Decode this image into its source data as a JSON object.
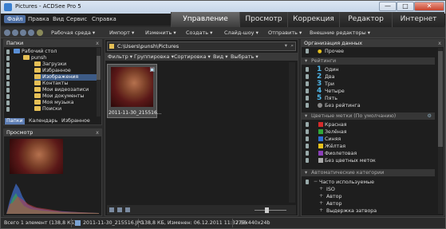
{
  "window": {
    "title": "Pictures - ACDSee Pro 5",
    "minimize": "—",
    "maximize": "□",
    "close": "✕"
  },
  "menu": [
    "Файл",
    "Правка",
    "Вид",
    "Сервис",
    "Справка"
  ],
  "modes": [
    "Управление",
    "Просмотр",
    "Коррекция",
    "Редактор",
    "Интернет"
  ],
  "toolbar": {
    "workspace": "Рабочая среда ▾",
    "items": [
      "Импорт ▾",
      "Изменить ▾",
      "Создать ▾",
      "Слайд-шоу ▾",
      "Отправить ▾",
      "Внешние редакторы ▾"
    ]
  },
  "folders_panel": {
    "title": "Папки",
    "close": "x",
    "items": [
      {
        "label": "Рабочий стол",
        "level": 0,
        "expanded": true
      },
      {
        "label": "punsh",
        "level": 1,
        "expanded": true
      },
      {
        "label": "Загрузки",
        "level": 2
      },
      {
        "label": "Избранное",
        "level": 2
      },
      {
        "label": "Изображения",
        "level": 2,
        "selected": true
      },
      {
        "label": "Контакты",
        "level": 2
      },
      {
        "label": "Мои видеозаписи",
        "level": 2
      },
      {
        "label": "Мои документы",
        "level": 2
      },
      {
        "label": "Моя музыка",
        "level": 2
      },
      {
        "label": "Поиски",
        "level": 2
      }
    ],
    "tabs": [
      "Папки",
      "Календарь",
      "Избранное"
    ]
  },
  "preview_panel": {
    "title": "Просмотр",
    "close": "x"
  },
  "browser": {
    "path": "C:\\Users\\punsh\\Pictures",
    "filter_bar": [
      "Фильтр ▾",
      "Группировка ▾",
      "Сортировка ▾",
      "Вид ▾",
      "Выбрать ▾"
    ],
    "thumb_caption": "2011-11-30_215516...",
    "thumb_badge": "▣"
  },
  "catalog": {
    "title": "Организация данных",
    "close": "x",
    "misc": "Прочее",
    "ratings_header": "Рейтинги",
    "ratings": [
      {
        "num": "1",
        "label": "Один"
      },
      {
        "num": "2",
        "label": "Два"
      },
      {
        "num": "3",
        "label": "Три"
      },
      {
        "num": "4",
        "label": "Четыре"
      },
      {
        "num": "5",
        "label": "Пять"
      }
    ],
    "no_rating": "Без рейтинга",
    "labels_header": "Цветные метки (По умолчанию)",
    "labels": [
      {
        "label": "Красная",
        "color": "#d42b2b"
      },
      {
        "label": "Зелёная",
        "color": "#31a838"
      },
      {
        "label": "Синяя",
        "color": "#2d6fd4"
      },
      {
        "label": "Жёлтая",
        "color": "#e8c21e"
      },
      {
        "label": "Фиолетовая",
        "color": "#8b3fb8"
      }
    ],
    "no_label": "Без цветных меток",
    "auto_header": "Автоматические категории",
    "auto_items": [
      {
        "label": "Часто используемые",
        "sub": false
      },
      {
        "label": "ISO",
        "sub": true
      },
      {
        "label": "Автор",
        "sub": true
      },
      {
        "label": "Автор",
        "sub": true
      },
      {
        "label": "Выдержка затвора",
        "sub": true
      }
    ]
  },
  "status": {
    "total": "Всего 1 элемент (138,8 КБ)",
    "filename": "2011-11-30_215516.JPG",
    "details": "138,8 КБ, Изменен: 06.12.2011 11:32:56",
    "dimensions": "775x440x24b"
  }
}
